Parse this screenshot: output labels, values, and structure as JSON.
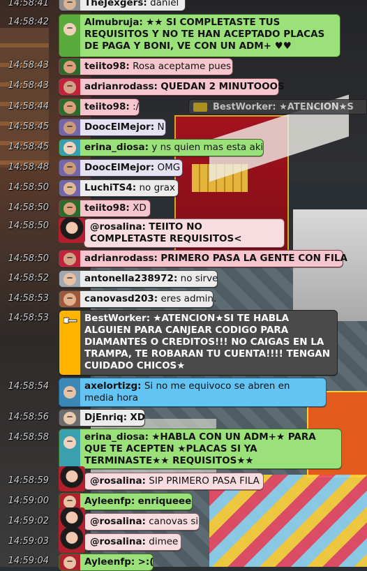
{
  "messages": [
    {
      "time": "14:58:41",
      "user": "TheJexgers:",
      "text": "daniel",
      "color": "grey"
    },
    {
      "time": "14:58:42",
      "user": "Almubruja:",
      "text": "★★ SI COMPLETASTE TUS REQUISITOS Y NO TE HAN ACEPTADO PLACAS DE PAGA Y BONI, VE CON UN ADM+ ♥♥",
      "color": "green",
      "bold": true
    },
    {
      "time": "14:58:43",
      "user": "teiito98:",
      "text": "Rosa aceptame pues",
      "color": "pink"
    },
    {
      "time": "14:58:43",
      "user": "adrianrodass:",
      "text": "QUEDAN 2 MINUTOOOS",
      "color": "pink",
      "bold": true
    },
    {
      "time": "14:58:44",
      "user": "teiito98:",
      "text": ":/",
      "color": "pink"
    },
    {
      "time": "14:58:45",
      "user": "DoocElMejor:",
      "text": "N",
      "color": "lav"
    },
    {
      "time": "14:58:45",
      "user": "erina_diosa:",
      "text": "y ns quien mas esta aki",
      "color": "green"
    },
    {
      "time": "14:58:48",
      "user": "DoocElMejor:",
      "text": "OMG",
      "color": "lav"
    },
    {
      "time": "14:58:50",
      "user": "LuchiTS4:",
      "text": "no grax",
      "color": "grey"
    },
    {
      "time": "14:58:50",
      "user": "teiito98:",
      "text": "XD",
      "color": "pink"
    },
    {
      "time": "14:58:50",
      "user": "@rosalina:",
      "text": "TEIITO NO COMPLETASTE REQUISITOS<",
      "color": "lpink",
      "bold": true
    },
    {
      "time": "14:58:50",
      "user": "adrianrodass:",
      "text": "PRIMERO PASA LA GENTE CON FILA",
      "color": "pink",
      "bold": true
    },
    {
      "time": "14:58:52",
      "user": "antonella238972:",
      "text": "no sirve",
      "color": "grey"
    },
    {
      "time": "14:58:53",
      "user": "canovasd203:",
      "text": "eres admin.",
      "color": "grey"
    },
    {
      "time": "14:58:53",
      "user": "BestWorker:",
      "text": "★ATENCION★SI TE HABLA ALGUIEN PARA CANJEAR CODIGO PARA DIAMANTES O CREDITOS!!! NO CAIGAS EN LA TRAMPA, TE ROBARAN TU CUENTA!!!! TENGAN CUIDADO CHICOS★",
      "color": "dark"
    },
    {
      "time": "14:58:54",
      "user": "axelortizg:",
      "text": "Si no me equivoco se abren en media hora",
      "color": "blue"
    },
    {
      "time": "14:58:56",
      "user": "DjEnriq:",
      "text": "XD",
      "color": "grey"
    },
    {
      "time": "14:58:58",
      "user": "erina_diosa:",
      "text": "★HABLA CON UN ADM+★ PARA QUE TE ACEPTEN ★PLACAS SI YA TERMINASTE★★ REQUISITOS★★",
      "color": "green",
      "bold": true
    },
    {
      "time": "14:58:59",
      "user": "@rosalina:",
      "text": "SIP PRIMERO PASA FILA",
      "color": "lpink"
    },
    {
      "time": "14:59:00",
      "user": "Ayleenfp:",
      "text": "enriqueee",
      "color": "green",
      "bold": true
    },
    {
      "time": "14:59:02",
      "user": "@rosalina:",
      "text": "canovas si",
      "color": "lpink"
    },
    {
      "time": "14:59:03",
      "user": "@rosalina:",
      "text": "dimee",
      "color": "lpink"
    },
    {
      "time": "14:59:04",
      "user": "Ayleenfp:",
      "text": ">:(",
      "color": "green",
      "bold": true
    }
  ],
  "background_badge": {
    "user": "BestWorker:",
    "text": "★ATENCION★S"
  },
  "colors": {
    "green": "#9be17a",
    "pink": "#f6c6cf",
    "lpink": "#f7dce0",
    "grey": "#ececec",
    "dark": "#4a4a4a",
    "blue": "#62c4f2",
    "lav": "#e6e2f2"
  }
}
